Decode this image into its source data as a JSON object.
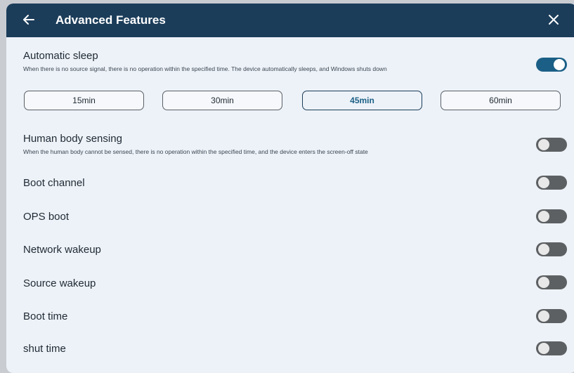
{
  "header": {
    "title": "Advanced Features",
    "back_icon": "arrow-left-icon",
    "close_icon": "close-icon"
  },
  "colors": {
    "header_bg": "#1b3d5a",
    "panel_bg": "#edf2f8",
    "accent": "#1b5f86",
    "toggle_off": "#5d6062"
  },
  "automatic_sleep": {
    "title": "Automatic sleep",
    "description": "When there is no source signal, there is no operation within the specified time. The device automatically sleeps, and Windows shuts down",
    "enabled": true,
    "options": [
      "15min",
      "30min",
      "45min",
      "60min"
    ],
    "selected": "45min"
  },
  "human_body_sensing": {
    "title": "Human body sensing",
    "description": "When the human body cannot be sensed, there is no operation within the specified time, and the device enters the screen-off state",
    "enabled": false
  },
  "settings": [
    {
      "label": "Boot channel",
      "enabled": false
    },
    {
      "label": "OPS boot",
      "enabled": false
    },
    {
      "label": "Network wakeup",
      "enabled": false
    },
    {
      "label": "Source wakeup",
      "enabled": false
    },
    {
      "label": "Boot time",
      "enabled": false
    },
    {
      "label": "shut time",
      "enabled": false
    }
  ]
}
